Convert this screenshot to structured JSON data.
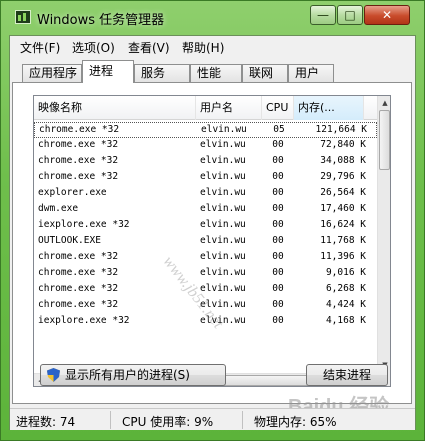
{
  "window": {
    "title": "Windows 任务管理器",
    "minimize_glyph": "—",
    "maximize_glyph": "□",
    "close_glyph": "✕"
  },
  "menu": [
    "文件(F)",
    "选项(O)",
    "查看(V)",
    "帮助(H)"
  ],
  "tabs": [
    {
      "label": "应用程序",
      "active": false
    },
    {
      "label": "进程",
      "active": true
    },
    {
      "label": "服务",
      "active": false
    },
    {
      "label": "性能",
      "active": false
    },
    {
      "label": "联网",
      "active": false
    },
    {
      "label": "用户",
      "active": false
    }
  ],
  "columns": {
    "name": "映像名称",
    "user": "用户名",
    "cpu": "CPU",
    "memory": "内存(..."
  },
  "processes": [
    {
      "name": "chrome.exe *32",
      "user": "elvin.wu",
      "cpu": "05",
      "mem": "121,664 K"
    },
    {
      "name": "chrome.exe *32",
      "user": "elvin.wu",
      "cpu": "00",
      "mem": "72,840 K"
    },
    {
      "name": "chrome.exe *32",
      "user": "elvin.wu",
      "cpu": "00",
      "mem": "34,088 K"
    },
    {
      "name": "chrome.exe *32",
      "user": "elvin.wu",
      "cpu": "00",
      "mem": "29,796 K"
    },
    {
      "name": "explorer.exe",
      "user": "elvin.wu",
      "cpu": "00",
      "mem": "26,564 K"
    },
    {
      "name": "dwm.exe",
      "user": "elvin.wu",
      "cpu": "00",
      "mem": "17,460 K"
    },
    {
      "name": "iexplore.exe *32",
      "user": "elvin.wu",
      "cpu": "00",
      "mem": "16,624 K"
    },
    {
      "name": "OUTLOOK.EXE",
      "user": "elvin.wu",
      "cpu": "00",
      "mem": "11,768 K"
    },
    {
      "name": "chrome.exe *32",
      "user": "elvin.wu",
      "cpu": "00",
      "mem": "11,396 K"
    },
    {
      "name": "chrome.exe *32",
      "user": "elvin.wu",
      "cpu": "00",
      "mem": "9,016 K"
    },
    {
      "name": "chrome.exe *32",
      "user": "elvin.wu",
      "cpu": "00",
      "mem": "6,268 K"
    },
    {
      "name": "chrome.exe *32",
      "user": "elvin.wu",
      "cpu": "00",
      "mem": "4,424 K"
    },
    {
      "name": "iexplore.exe *32",
      "user": "elvin.wu",
      "cpu": "00",
      "mem": "4,168 K"
    }
  ],
  "buttons": {
    "show_all": "显示所有用户的进程(S)",
    "end_process": "结束进程"
  },
  "status": {
    "processes": "进程数: 74",
    "cpu": "CPU 使用率: 9%",
    "memory": "物理内存: 65%"
  },
  "watermarks": {
    "diagonal": "www.jb51.net",
    "baidu": "Baidu 经验"
  },
  "colors": {
    "frame": "#6fbf4c",
    "close": "#c94b2b"
  }
}
